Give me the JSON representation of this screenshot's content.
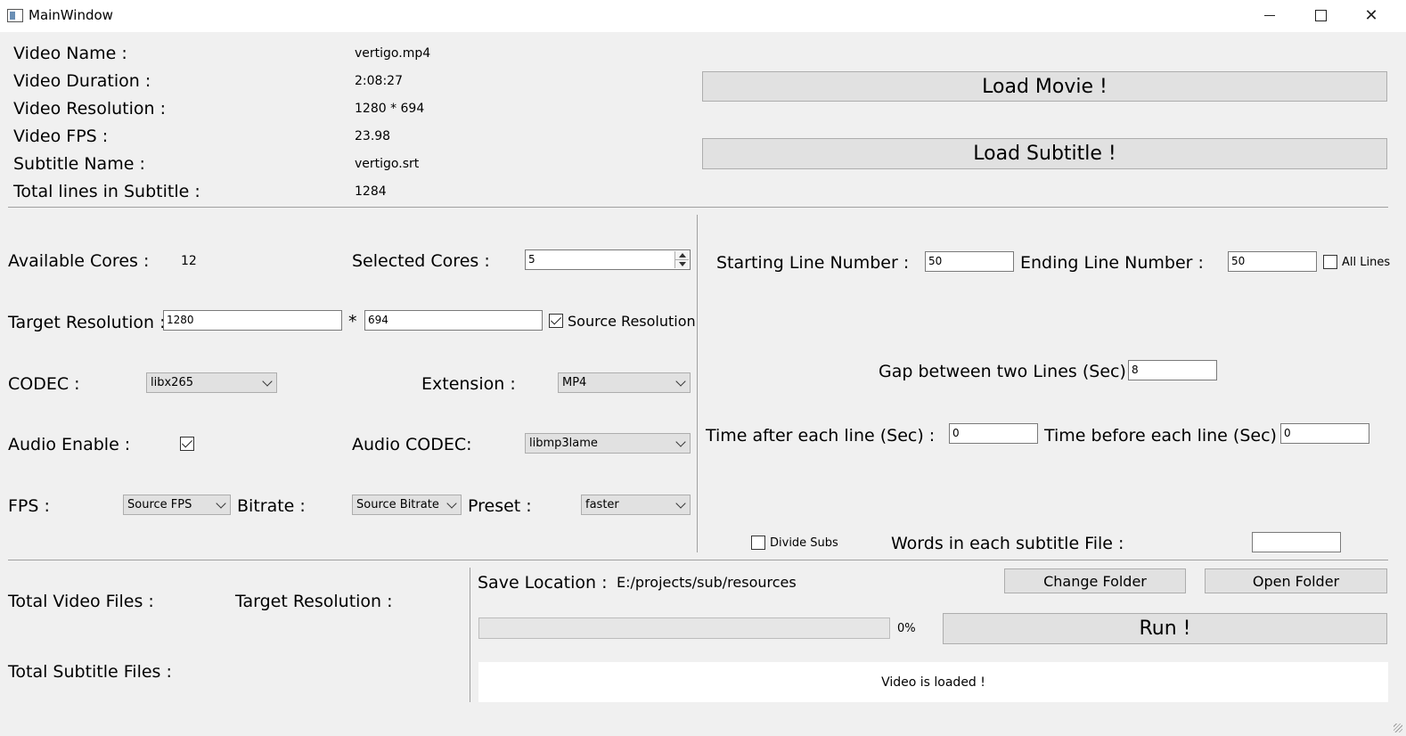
{
  "window": {
    "title": "MainWindow",
    "minimize_glyph": "—",
    "maximize_glyph": "☐",
    "close_glyph": "✕"
  },
  "info": {
    "video_name_label": "Video Name :",
    "video_name": "vertigo.mp4",
    "duration_label": "Video Duration :",
    "duration": "2:08:27",
    "resolution_label": "Video Resolution :",
    "resolution": "1280 * 694",
    "fps_label": "Video FPS :",
    "fps": "23.98",
    "subtitle_label": "Subtitle Name :",
    "subtitle": "vertigo.srt",
    "lines_label": "Total lines in Subtitle :",
    "lines": "1284"
  },
  "load": {
    "movie_button": "Load Movie !",
    "subtitle_button": "Load Subtitle !"
  },
  "settings": {
    "available_cores_label": "Available Cores :",
    "available_cores": "12",
    "selected_cores_label": "Selected Cores :",
    "selected_cores": "5",
    "target_resolution_label": "Target Resolution :",
    "target_width": "1280",
    "times": "*",
    "target_height": "694",
    "source_resolution_label": "Source Resolution",
    "source_resolution_checked": true,
    "codec_label": "CODEC :",
    "codec": "libx265",
    "extension_label": "Extension :",
    "extension": "MP4",
    "audio_enable_label": "Audio Enable :",
    "audio_enabled": true,
    "audio_codec_label": "Audio CODEC:",
    "audio_codec": "libmp3lame",
    "fps_label": "FPS :",
    "fps": "Source FPS",
    "bitrate_label": "Bitrate :",
    "bitrate": "Source Bitrate",
    "preset_label": "Preset :",
    "preset": "faster"
  },
  "lines": {
    "start_label": "Starting Line Number :",
    "start": "50",
    "end_label": "Ending Line Number :",
    "end": "50",
    "all_lines_label": "All Lines",
    "all_lines_checked": false,
    "gap_label": "Gap between two Lines (Sec) :",
    "gap": "8",
    "after_label": "Time after each line (Sec) :",
    "after": "0",
    "before_label": "Time before each line (Sec) :",
    "before": "0",
    "divide_subs_label": "Divide Subs",
    "divide_subs_checked": false,
    "words_label": "Words in each subtitle File :",
    "words": ""
  },
  "output": {
    "total_video_label": "Total Video Files :",
    "target_resolution_label": "Target Resolution :",
    "total_subtitle_label": "Total Subtitle Files :",
    "save_location_label": "Save Location :",
    "save_location": "E:/projects/sub/resources",
    "change_folder_button": "Change Folder",
    "open_folder_button": "Open Folder",
    "progress_percent": 0,
    "progress_text": "0%",
    "run_button": "Run !",
    "status": "Video is loaded !"
  }
}
